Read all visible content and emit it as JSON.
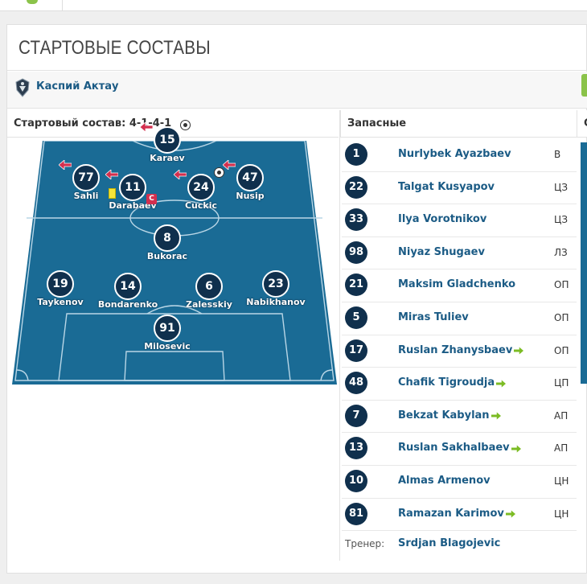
{
  "section_title": "СТАРТОВЫЕ СОСТАВЫ",
  "team": {
    "name": "Каспий Актау",
    "logo_icon": "club-crest-icon"
  },
  "columns": {
    "starting": "Стартовый состав: 4-1-4-1",
    "substitutes": "Запасные",
    "right_stub": "С"
  },
  "colors": {
    "pitch": "#1a6b95",
    "player_badge": "#10304d",
    "link": "#1b5b85",
    "sub_in_arrow": "#7cbc24",
    "sub_out_arrow": "#d32f4e"
  },
  "starting_xi": [
    {
      "number": "15",
      "name": "Karaev",
      "subbed_off": true,
      "goal": true
    },
    {
      "number": "77",
      "name": "Sahli",
      "subbed_off": true
    },
    {
      "number": "11",
      "name": "Darabaev",
      "subbed_off": true,
      "yellow_card": true,
      "captain": "C"
    },
    {
      "number": "24",
      "name": "Cuckic",
      "subbed_off": true,
      "goal": true
    },
    {
      "number": "47",
      "name": "Nusip",
      "subbed_off": true
    },
    {
      "number": "8",
      "name": "Bukorac"
    },
    {
      "number": "19",
      "name": "Taykenov"
    },
    {
      "number": "14",
      "name": "Bondarenko"
    },
    {
      "number": "6",
      "name": "Zalesskiy"
    },
    {
      "number": "23",
      "name": "Nabikhanov"
    },
    {
      "number": "91",
      "name": "Milosevic"
    }
  ],
  "substitutes": [
    {
      "number": "1",
      "name": "Nurlybek Ayazbaev",
      "pos": "В",
      "subbed_on": false
    },
    {
      "number": "22",
      "name": "Talgat Kusyapov",
      "pos": "ЦЗ",
      "subbed_on": false
    },
    {
      "number": "33",
      "name": "Ilya Vorotnikov",
      "pos": "ЦЗ",
      "subbed_on": false
    },
    {
      "number": "98",
      "name": "Niyaz Shugaev",
      "pos": "ЛЗ",
      "subbed_on": false
    },
    {
      "number": "21",
      "name": "Maksim Gladchenko",
      "pos": "ОП",
      "subbed_on": false
    },
    {
      "number": "5",
      "name": "Miras Tuliev",
      "pos": "ОП",
      "subbed_on": false
    },
    {
      "number": "17",
      "name": "Ruslan Zhanysbaev",
      "pos": "ОП",
      "subbed_on": true
    },
    {
      "number": "48",
      "name": "Chafik Tigroudja",
      "pos": "ЦП",
      "subbed_on": true
    },
    {
      "number": "7",
      "name": "Bekzat Kabylan",
      "pos": "АП",
      "subbed_on": true
    },
    {
      "number": "13",
      "name": "Ruslan Sakhalbaev",
      "pos": "АП",
      "subbed_on": true
    },
    {
      "number": "10",
      "name": "Almas Armenov",
      "pos": "ЦН",
      "subbed_on": false
    },
    {
      "number": "81",
      "name": "Ramazan Karimov",
      "pos": "ЦН",
      "subbed_on": true
    }
  ],
  "coach": {
    "label": "Тренер:",
    "name": "Srdjan Blagojevic"
  }
}
